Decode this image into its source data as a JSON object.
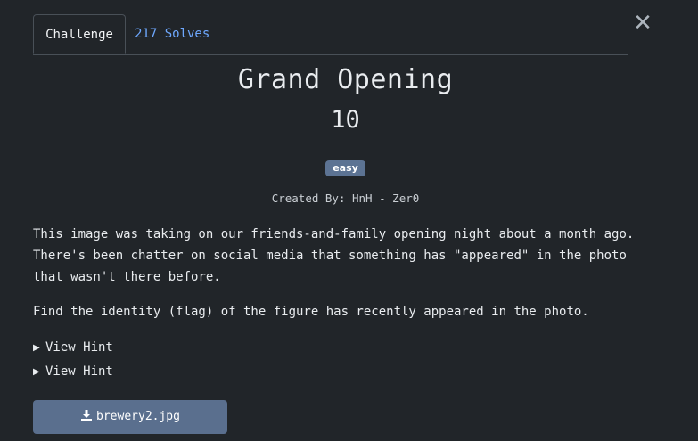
{
  "tabs": {
    "challenge_label": "Challenge",
    "solves_label": "217 Solves"
  },
  "close": {
    "glyph": "✕"
  },
  "challenge": {
    "name": "Grand Opening",
    "points": "10",
    "tag": "easy",
    "author": "Created By: HnH - Zer0",
    "description": "This image was taking on our friends-and-family opening night about a month ago. There's been chatter on social media that something has \"appeared\" in the photo that wasn't there before.",
    "description_2": "Find the identity (flag) of the figure has recently appeared in the photo."
  },
  "hints": [
    {
      "label": "View Hint"
    },
    {
      "label": "View Hint"
    }
  ],
  "file": {
    "name": "brewery2.jpg",
    "icon": "download-icon"
  },
  "colors": {
    "background": "#212529",
    "accent_link": "#6ea8fe",
    "badge": "#5c7393",
    "button": "#5a6f8e"
  }
}
